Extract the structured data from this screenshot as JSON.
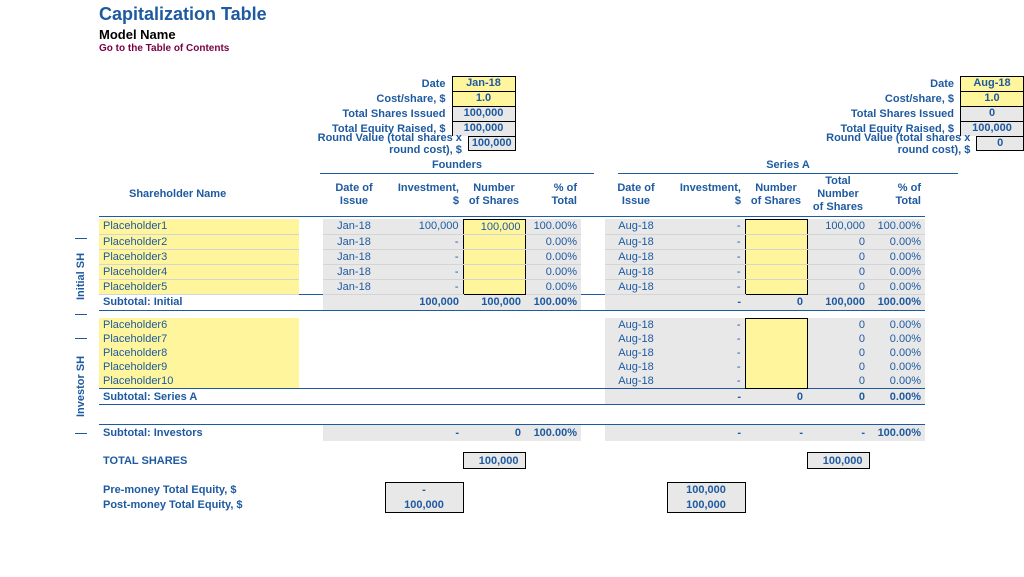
{
  "header": {
    "title": "Capitalization Table",
    "subtitle": "Model Name",
    "toc": "Go to the Table of Contents"
  },
  "summary_labels": {
    "date": "Date",
    "cost": "Cost/share, $",
    "shares": "Total Shares Issued",
    "equity": "Total Equity Raised, $",
    "round": "Round Value (total shares x round cost), $"
  },
  "founders": {
    "heading": "Founders",
    "date": "Jan-18",
    "cost": "1.0",
    "shares": "100,000",
    "equity": "100,000",
    "round": "100,000"
  },
  "seriesA": {
    "heading": "Series A",
    "date": "Aug-18",
    "cost": "1.0",
    "shares": "0",
    "equity": "100,000",
    "round": "0"
  },
  "cols": {
    "name": "Shareholder Name",
    "dateIssue": "Date of Issue",
    "investment": "Investment, $",
    "numShares": "Number of Shares",
    "totalNumShares": "Total Number of Shares",
    "pctTotal": "% of Total"
  },
  "initial_label": "Initial SH",
  "investor_label": "Investor SH",
  "initial": [
    {
      "name": "Placeholder1",
      "fd": "Jan-18",
      "fi": "100,000",
      "fs": "100,000",
      "fp": "100.00%",
      "ad": "Aug-18",
      "ai": "-",
      "as": "",
      "at": "100,000",
      "ap": "100.00%"
    },
    {
      "name": "Placeholder2",
      "fd": "Jan-18",
      "fi": "-",
      "fs": "",
      "fp": "0.00%",
      "ad": "Aug-18",
      "ai": "-",
      "as": "",
      "at": "0",
      "ap": "0.00%"
    },
    {
      "name": "Placeholder3",
      "fd": "Jan-18",
      "fi": "-",
      "fs": "",
      "fp": "0.00%",
      "ad": "Aug-18",
      "ai": "-",
      "as": "",
      "at": "0",
      "ap": "0.00%"
    },
    {
      "name": "Placeholder4",
      "fd": "Jan-18",
      "fi": "-",
      "fs": "",
      "fp": "0.00%",
      "ad": "Aug-18",
      "ai": "-",
      "as": "",
      "at": "0",
      "ap": "0.00%"
    },
    {
      "name": "Placeholder5",
      "fd": "Jan-18",
      "fi": "-",
      "fs": "",
      "fp": "0.00%",
      "ad": "Aug-18",
      "ai": "-",
      "as": "",
      "at": "0",
      "ap": "0.00%"
    }
  ],
  "subtotal_initial": {
    "label": "Subtotal: Initial",
    "fi": "100,000",
    "fs": "100,000",
    "fp": "100.00%",
    "ai": "-",
    "as": "0",
    "at": "100,000",
    "ap": "100.00%"
  },
  "investors": [
    {
      "name": "Placeholder6",
      "ad": "Aug-18",
      "ai": "-",
      "as": "",
      "at": "0",
      "ap": "0.00%"
    },
    {
      "name": "Placeholder7",
      "ad": "Aug-18",
      "ai": "-",
      "as": "",
      "at": "0",
      "ap": "0.00%"
    },
    {
      "name": "Placeholder8",
      "ad": "Aug-18",
      "ai": "-",
      "as": "",
      "at": "0",
      "ap": "0.00%"
    },
    {
      "name": "Placeholder9",
      "ad": "Aug-18",
      "ai": "-",
      "as": "",
      "at": "0",
      "ap": "0.00%"
    },
    {
      "name": "Placeholder10",
      "ad": "Aug-18",
      "ai": "-",
      "as": "",
      "at": "0",
      "ap": "0.00%"
    }
  ],
  "subtotal_seriesA": {
    "label": "Subtotal: Series A",
    "ai": "-",
    "as": "0",
    "at": "0",
    "ap": "0.00%"
  },
  "subtotal_investors": {
    "label": "Subtotal: Investors",
    "fi": "-",
    "fs": "0",
    "fp": "100.00%",
    "ai": "-",
    "as": "-",
    "at": "-",
    "ap": "100.00%"
  },
  "total_shares": {
    "label": "TOTAL SHARES",
    "f": "100,000",
    "a": "100,000"
  },
  "pre_money": {
    "label": "Pre-money Total Equity, $",
    "f": "-",
    "a": "100,000"
  },
  "post_money": {
    "label": "Post-money Total Equity, $",
    "f": "100,000",
    "a": "100,000"
  }
}
